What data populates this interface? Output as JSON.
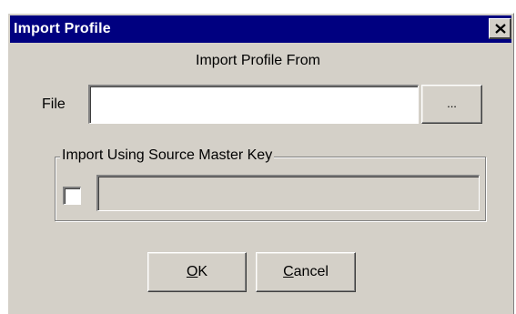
{
  "window": {
    "title": "Import Profile",
    "close_icon": "close-icon"
  },
  "main": {
    "heading": "Import Profile From",
    "file_label": "File",
    "file_value": "",
    "browse_label": "...",
    "group_label": "Import Using Source Master Key",
    "checkbox_checked": false,
    "key_value": ""
  },
  "buttons": {
    "ok_mnemonic": "O",
    "ok_rest": "K",
    "cancel_mnemonic": "C",
    "cancel_rest": "ancel"
  },
  "colors": {
    "titlebar": "#000080",
    "dialog_face": "#d4d0c8"
  }
}
